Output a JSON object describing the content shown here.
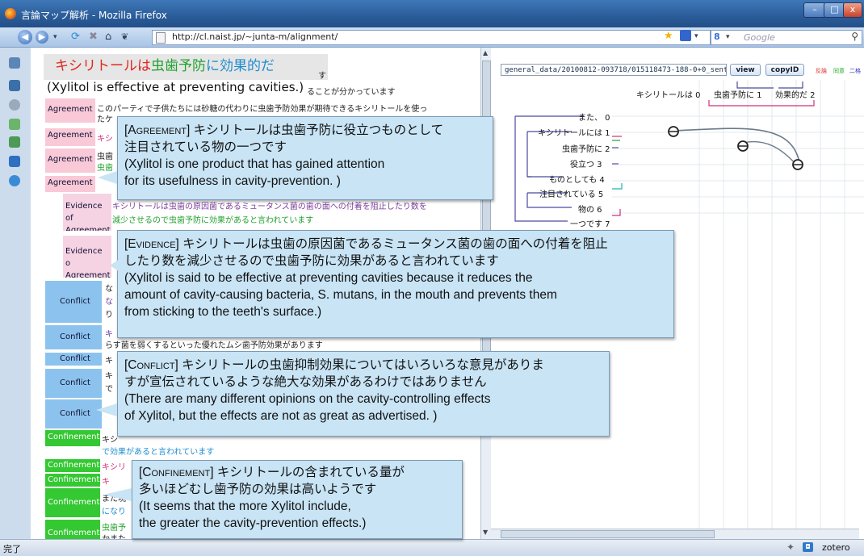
{
  "window": {
    "title": "言論マップ解析 - Mozilla Firefox",
    "min_label": "–",
    "max_label": "□",
    "close_label": "x"
  },
  "nav": {
    "url": "http://cl.naist.jp/~junta-m/alignment/",
    "search_engine_label": "8",
    "search_placeholder": "Google",
    "back_icon": "back-arrow-icon",
    "forward_icon": "forward-arrow-icon"
  },
  "topic": {
    "title_part1": "キシリトールは",
    "title_part2": "虫歯予防",
    "title_part3": "に効果的だ",
    "translation": "(Xylitol is effective at preventing cavities.)",
    "color_red": "#e0281e",
    "color_green": "#20a12d",
    "color_blue": "#1f8ccf"
  },
  "left_pane": {
    "bg_lines": [
      "す",
      "ることが分かっています",
      "このパーティで子供たちには砂糖の代わりに虫歯予防効果が期待できるキシリトールを使っ",
      "たケ"
    ],
    "labels": {
      "agreement": "Agreement",
      "evidence": "Evidence of Agreement",
      "evidence2": "Evidence o Agreement",
      "conflict": "Conflict",
      "confinement": "Confinement"
    },
    "sentences": {
      "evidence_1a": "キシリトールは虫歯の原因菌であるミュータンス菌の歯の面への付着を阻止したり数を",
      "evidence_1b": "減少させるので虫歯予防に効果があると言われています",
      "agree_2": "キシ",
      "agree_3": "虫歯",
      "agree_3b": "虫歯",
      "conflict_1": "な",
      "conflict_1b": "な",
      "conflict_1c": "り",
      "conflict_2": "キ",
      "conflict_2b": "らす菌を弱くするといった優れたムシ歯予防効果があります",
      "conflict_3": "キ",
      "conflict_4": "キ",
      "conflict_4b": "で",
      "confine_1": "キシ",
      "confine_1b": "で効果があると言われています",
      "confine_2": "キシリ",
      "confine_3": "キ",
      "confine_4": "また現",
      "confine_4b": "になり",
      "confine_5": "虫歯予",
      "confine_5b": "かまた"
    }
  },
  "right_pane": {
    "path_value": "general_data/20100812-093718/015118473-188-0+0_sent.alignr",
    "view_button": "view",
    "copyid_button": "copyID",
    "mini_legend": [
      "反論",
      "同意",
      "二格"
    ],
    "top_chunks": [
      "キシリトールは 0",
      "虫歯予防に 1",
      "効果的だ 2"
    ],
    "tree_chunks": [
      "また、 0",
      "キシリトールには 1",
      "虫歯予防に 2",
      "役立つ 3",
      "ものとしても 4",
      "注目されている 5",
      "物の 6",
      "一つです 7"
    ]
  },
  "callouts": {
    "agreement": {
      "tag": "[Agreement]",
      "jp1": " キシリトールは虫歯予防に役立つものとして",
      "jp2": "注目されている物の一つです",
      "en1": "(Xylitol is one product that has gained attention",
      "en2": "for its usefulness in cavity-prevention. )"
    },
    "evidence": {
      "tag": "[Evidence]",
      "jp1": " キシリトールは虫歯の原因菌であるミュータンス菌の歯の面への付着を阻止",
      "jp2": "したり数を減少させるので虫歯予防に効果があると言われています",
      "en1": " (Xylitol is said to be effective at preventing cavities because it reduces the",
      "en2": "amount of cavity-causing bacteria, S. mutans, in the mouth and prevents them",
      "en3": "from sticking to the teeth's surface.)"
    },
    "conflict": {
      "tag": "[Conflict]",
      "jp1": " キシリトールの虫歯抑制効果についてはいろいろな意見がありま",
      "jp2": "すが宣伝されているような絶大な効果があるわけではありません",
      "en1": "(There are many different opinions on the cavity-controlling effects",
      "en2": "of Xylitol, but the effects are not as great as advertised. )"
    },
    "confinement": {
      "tag": "[Confinement]",
      "jp1": " キシリトールの含まれている量が",
      "jp2": "多いほどむし歯予防の効果は高いようです",
      "en1": "(It seems that the more Xylitol include,",
      "en2": "the greater the cavity-prevention effects.)"
    }
  },
  "status": {
    "text": "完了",
    "zotero": "zotero"
  }
}
